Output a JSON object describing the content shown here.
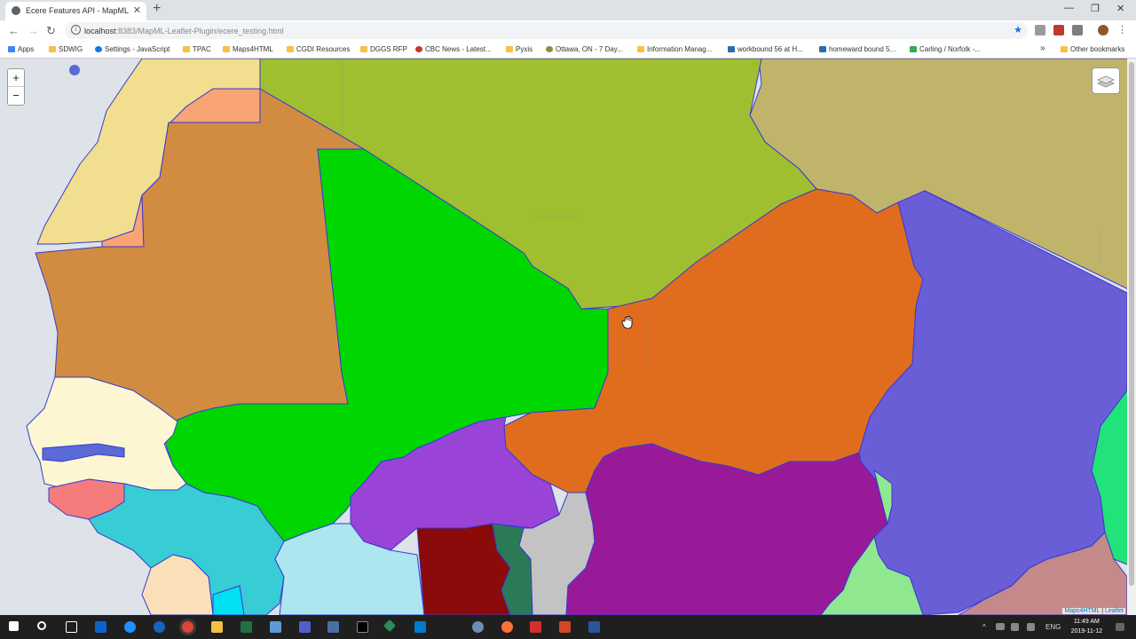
{
  "browser": {
    "tab_title": "Ecere Features API - MapML WG",
    "tab_close": "✕",
    "new_tab": "+",
    "url_host": "localhost",
    "url_path": ":8383/MapML-Leaflet-Plugin/ecere_testing.html",
    "url_info": "i",
    "back_icon": "←",
    "forward_icon": "→",
    "reload_icon": "↻",
    "star_icon": "★",
    "menu_icon": "⋮",
    "win_minimize": "—",
    "win_restore": "❐",
    "win_close": "✕"
  },
  "bookmarks": {
    "items": [
      "Apps",
      "SDWIG",
      "Settings - JavaScript",
      "TPAC",
      "Maps4HTML",
      "CGDI Resources",
      "DGGS RFP",
      "CBC News - Latest...",
      "Pyxis",
      "Ottawa, ON - 7 Day...",
      "Information Manag...",
      "workbound 56 at H...",
      "homeward bound 5...",
      "Carling / Norfolk -..."
    ],
    "overflow": "»",
    "other": "Other bookmarks"
  },
  "map": {
    "zoom_in": "+",
    "zoom_out": "−",
    "attribution_link1": "Maps4HTML",
    "attribution_sep": " | ",
    "attribution_link2": "Leaflet",
    "colors": {
      "ocean": "#dde3e8",
      "algeria": "#a0bf30",
      "libya": "#c0b46a",
      "morocco": "#f2de8f",
      "western_sahara": "#f8a474",
      "mauritania": "#d18c42",
      "mali": "#00d600",
      "niger": "#e06d1e",
      "chad": "#6a5ed6",
      "senegal": "#fdf6d2",
      "gambia": "#5a6ad6",
      "guinea_bissau": "#f47c7c",
      "guinea": "#38cdd4",
      "sierra_leone": "#fae0b8",
      "liberia": "#00e0f0",
      "cote_divoire": "#aee6f0",
      "burkina_faso": "#9944d6",
      "ghana": "#8b0a0a",
      "togo": "#2a7a55",
      "benin": "#c3c3c3",
      "nigeria": "#991a99",
      "cameroon": "#8fe890",
      "sudan_edge": "#22e27a",
      "car": "#c48a8a",
      "border": "#3a3ad0"
    }
  },
  "taskbar": {
    "tray_lang": "ENG",
    "tray_caret": "^",
    "time": "11:49 AM",
    "date": "2019-11-12"
  }
}
